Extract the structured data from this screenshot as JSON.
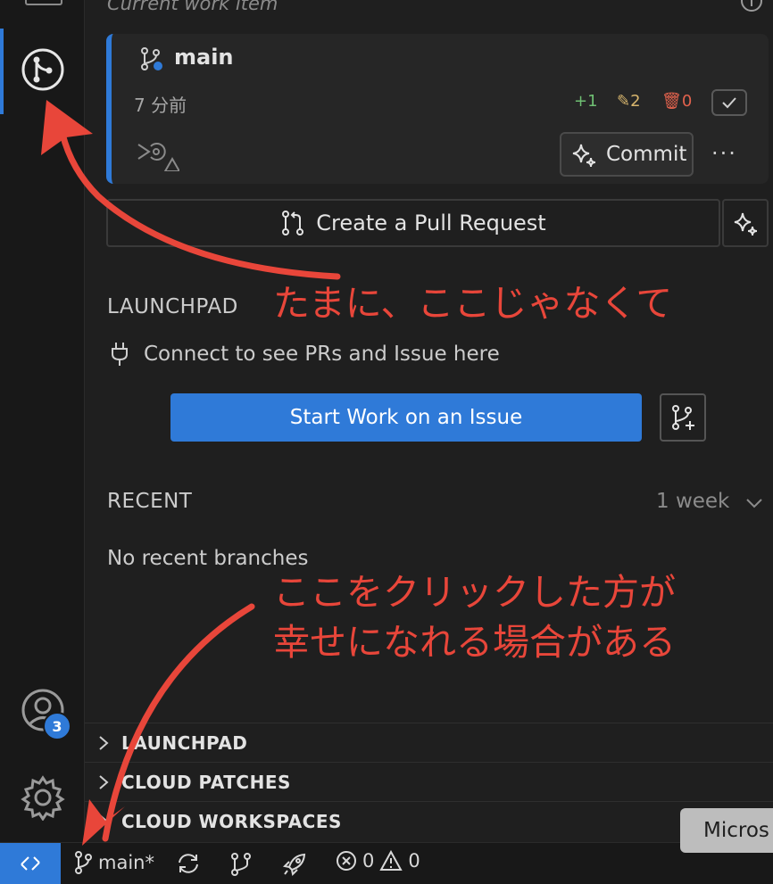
{
  "activity_bar": {
    "accounts_badge": "3"
  },
  "panel": {
    "current_work_title": "Current work item",
    "work_item": {
      "branch": "main",
      "time_ago": "7 分前",
      "added": "+1",
      "modified": "2",
      "deleted": "0",
      "commit_label": "Commit",
      "more_label": "···"
    },
    "create_pr_label": "Create a Pull Request",
    "launchpad": {
      "title": "LAUNCHPAD",
      "connect_text": "Connect to see PRs and Issue here",
      "start_work_label": "Start Work on an Issue"
    },
    "recent": {
      "title": "RECENT",
      "range": "1 week",
      "empty_text": "No recent branches"
    },
    "sections": [
      "LAUNCHPAD",
      "CLOUD PATCHES",
      "CLOUD WORKSPACES"
    ]
  },
  "status_bar": {
    "branch_label": "main*",
    "errors": "0",
    "warnings": "0",
    "tooltip": "Micros"
  },
  "annotations": {
    "note_1": "たまに、ここじゃなくて",
    "note_2_line1": "ここをクリックした方が",
    "note_2_line2": "幸せになれる場合がある"
  },
  "colors": {
    "accent": "#2f7ad8",
    "annotation": "#e8463a",
    "added": "#6fbf73",
    "modified": "#d7b56d",
    "deleted": "#e2624d"
  }
}
